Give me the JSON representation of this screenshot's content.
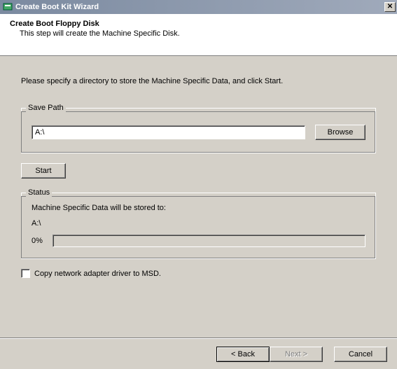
{
  "window": {
    "title": "Create Boot Kit Wizard"
  },
  "header": {
    "heading": "Create Boot Floppy Disk",
    "subtext": "This step will create the Machine Specific Disk."
  },
  "instruction": "Please specify a directory to store the Machine Specific Data, and click Start.",
  "savePath": {
    "legend": "Save Path",
    "value": "A:\\",
    "browse_label": "Browse"
  },
  "start_label": "Start",
  "status": {
    "legend": "Status",
    "line1": "Machine Specific Data will be stored to:",
    "line2": "A:\\",
    "percent": "0%"
  },
  "checkbox": {
    "label": "Copy network adapter driver to MSD."
  },
  "footer": {
    "back_label": "< Back",
    "next_label": "Next >",
    "cancel_label": "Cancel"
  }
}
